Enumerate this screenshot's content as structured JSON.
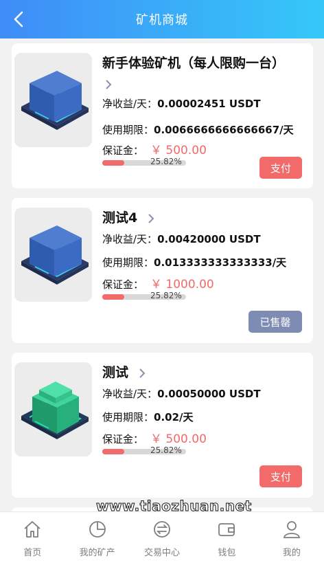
{
  "header": {
    "title": "矿机商城",
    "back_icon": "chevron-left-icon"
  },
  "products": [
    {
      "name": "新手体验矿机（每人限购一台）",
      "income_label": "净收益/天：",
      "income_value": "0.00002451 USDT",
      "period_label": "使用期限：",
      "period_value": "0.0066666666666667/天",
      "deposit_label": "保证金：",
      "deposit_value": "￥ 500.00",
      "progress": "25.82%",
      "progress_fraction": 0.2582,
      "button_label": "支付",
      "button_state": "pay",
      "image": "blue-mining-cube"
    },
    {
      "name": "测试4",
      "income_label": "净收益/天：",
      "income_value": "0.00420000 USDT",
      "period_label": "使用期限：",
      "period_value": "0.013333333333333/天",
      "deposit_label": "保证金：",
      "deposit_value": "￥ 1000.00",
      "progress": "25.82%",
      "progress_fraction": 0.2582,
      "button_label": "已售罄",
      "button_state": "sold",
      "image": "blue-mining-cube"
    },
    {
      "name": "测试",
      "income_label": "净收益/天：",
      "income_value": "0.00050000 USDT",
      "period_label": "使用期限：",
      "period_value": "0.02/天",
      "deposit_label": "保证金：",
      "deposit_value": "￥ 500.00",
      "progress": "25.82%",
      "progress_fraction": 0.2582,
      "button_label": "支付",
      "button_state": "pay",
      "image": "green-mining-cube"
    }
  ],
  "colors": {
    "header_start": "#3f8cf7",
    "header_end": "#35c8f9",
    "accent_red": "#f26a6a",
    "sold_gray": "#7e8cb4"
  },
  "tabbar": [
    {
      "label": "首页",
      "icon": "home-icon"
    },
    {
      "label": "我的矿产",
      "icon": "pie-chart-icon"
    },
    {
      "label": "交易中心",
      "icon": "exchange-icon"
    },
    {
      "label": "钱包",
      "icon": "wallet-icon"
    },
    {
      "label": "我的",
      "icon": "user-icon"
    }
  ],
  "watermark": "www.tiaozhuan.net"
}
